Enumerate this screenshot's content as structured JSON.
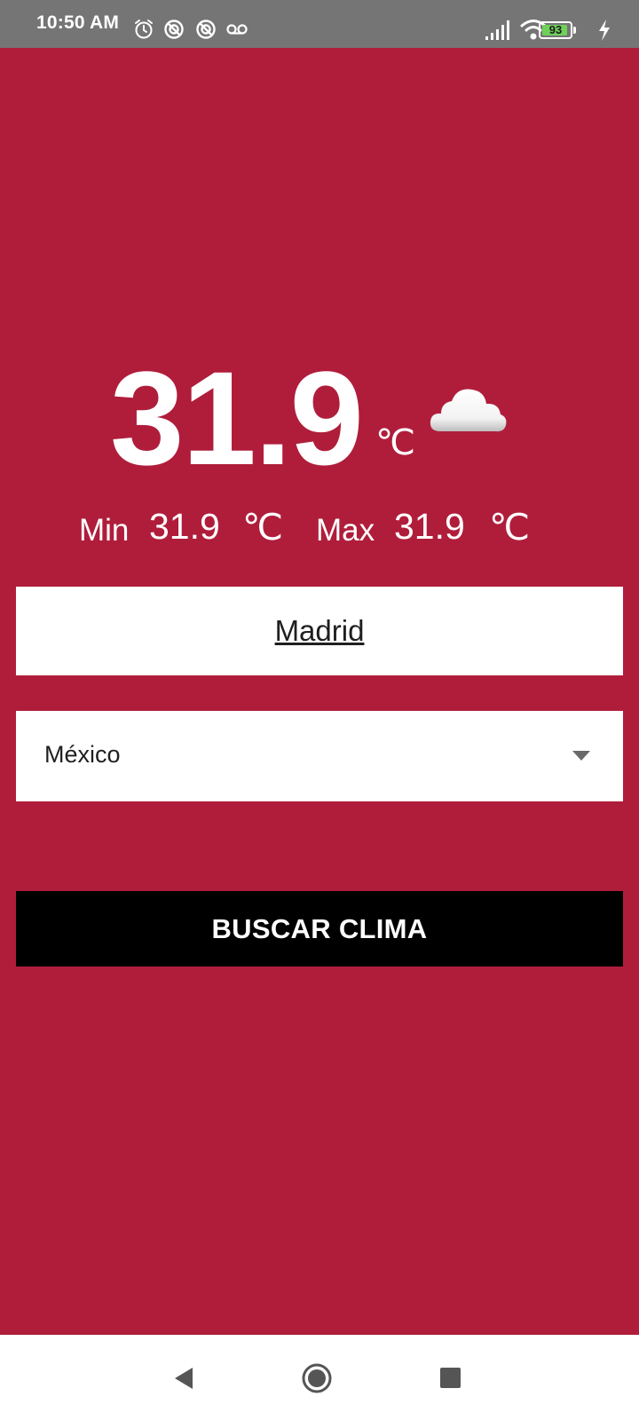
{
  "status_bar": {
    "time": "10:50 AM",
    "left_icons": [
      "alarm-icon",
      "data-saver-icon",
      "data-saver-icon",
      "voicemail-icon"
    ],
    "right_icons": [
      "signal-icon",
      "wifi-icon",
      "battery-icon",
      "charging-icon"
    ],
    "battery_level": "93",
    "battery_fraction": 0.93
  },
  "weather": {
    "current_temp": "31.9",
    "unit": "℃",
    "icon": "cloud-icon",
    "min_label": "Min",
    "min_value": "31.9",
    "min_unit": "℃",
    "max_label": "Max",
    "max_value": "31.9",
    "max_unit": "℃"
  },
  "form": {
    "city_value": "Madrid",
    "country_selected": "México",
    "submit_label": "BUSCAR CLIMA"
  },
  "nav_bar": {
    "icons": [
      "back-icon",
      "home-icon",
      "recents-icon"
    ]
  },
  "colors": {
    "background": "#b01d3b",
    "status_bar": "#757575",
    "button": "#000000",
    "battery": "#6fd15a"
  }
}
